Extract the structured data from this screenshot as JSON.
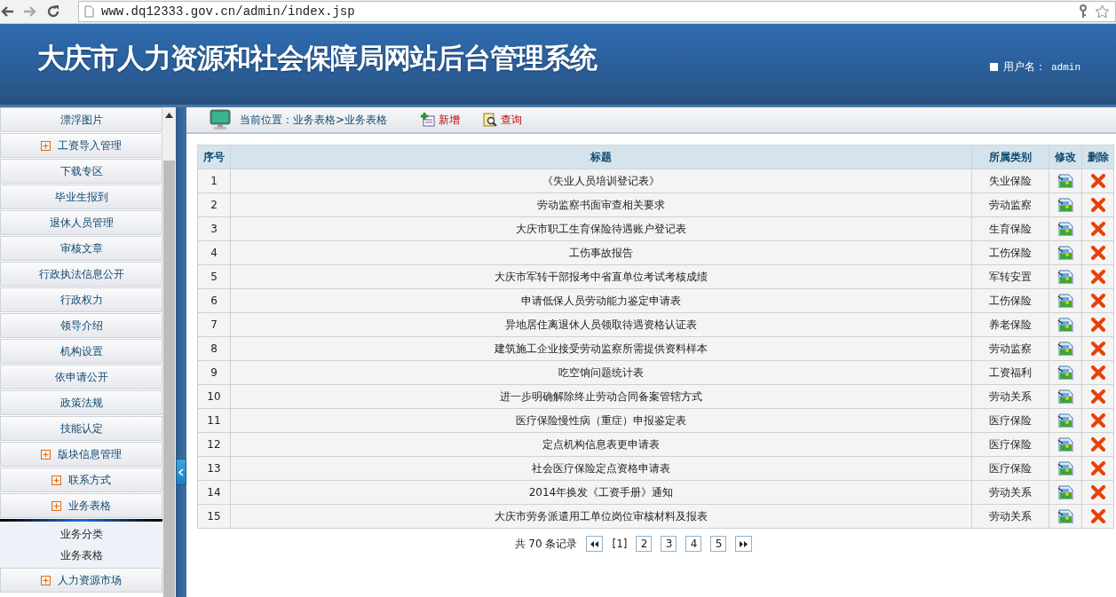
{
  "browser": {
    "url": "www.dq12333.gov.cn/admin/index.jsp"
  },
  "header": {
    "title": "大庆市人力资源和社会保障局网站后台管理系统",
    "user_label": "用户名：",
    "user_name": "admin"
  },
  "sidebar": {
    "items": [
      {
        "label": "漂浮图片",
        "kind": "link"
      },
      {
        "label": "工资导入管理",
        "kind": "group"
      },
      {
        "label": "下载专区",
        "kind": "link"
      },
      {
        "label": "毕业生报到",
        "kind": "link"
      },
      {
        "label": "退休人员管理",
        "kind": "link"
      },
      {
        "label": "审核文章",
        "kind": "link"
      },
      {
        "label": "行政执法信息公开",
        "kind": "link"
      },
      {
        "label": "行政权力",
        "kind": "link"
      },
      {
        "label": "领导介绍",
        "kind": "link"
      },
      {
        "label": "机构设置",
        "kind": "link"
      },
      {
        "label": "依申请公开",
        "kind": "link"
      },
      {
        "label": "政策法规",
        "kind": "link"
      },
      {
        "label": "技能认定",
        "kind": "link"
      },
      {
        "label": "版块信息管理",
        "kind": "group"
      },
      {
        "label": "联系方式",
        "kind": "group"
      },
      {
        "label": "业务表格",
        "kind": "group",
        "children": [
          {
            "label": "业务分类"
          },
          {
            "label": "业务表格"
          }
        ]
      },
      {
        "label": "人力资源市场",
        "kind": "group"
      }
    ]
  },
  "toolbar": {
    "location": "当前位置：业务表格>业务表格",
    "actions": [
      {
        "label": "新增",
        "kind": "add"
      },
      {
        "label": "查询",
        "kind": "search"
      }
    ]
  },
  "table": {
    "columns": [
      "序号",
      "标题",
      "所属类别",
      "修改",
      "删除"
    ],
    "rows": [
      {
        "no": "1",
        "title": "《失业人员培训登记表》",
        "category": "失业保险"
      },
      {
        "no": "2",
        "title": "劳动监察书面审查相关要求",
        "category": "劳动监察"
      },
      {
        "no": "3",
        "title": "大庆市职工生育保险待遇账户登记表",
        "category": "生育保险"
      },
      {
        "no": "4",
        "title": "工伤事故报告",
        "category": "工伤保险"
      },
      {
        "no": "5",
        "title": "大庆市军转干部报考中省直单位考试考核成绩",
        "category": "军转安置"
      },
      {
        "no": "6",
        "title": "申请低保人员劳动能力鉴定申请表",
        "category": "工伤保险"
      },
      {
        "no": "7",
        "title": "异地居住离退休人员领取待遇资格认证表",
        "category": "养老保险"
      },
      {
        "no": "8",
        "title": "建筑施工企业接受劳动监察所需提供资料样本",
        "category": "劳动监察"
      },
      {
        "no": "9",
        "title": "吃空饷问题统计表",
        "category": "工资福利"
      },
      {
        "no": "10",
        "title": "进一步明确解除终止劳动合同备案管辖方式",
        "category": "劳动关系"
      },
      {
        "no": "11",
        "title": "医疗保险慢性病（重症）申报鉴定表",
        "category": "医疗保险"
      },
      {
        "no": "12",
        "title": "定点机构信息表更申请表",
        "category": "医疗保险"
      },
      {
        "no": "13",
        "title": "社会医疗保险定点资格申请表",
        "category": "医疗保险"
      },
      {
        "no": "14",
        "title": "2014年换发《工资手册》通知",
        "category": "劳动关系"
      },
      {
        "no": "15",
        "title": "大庆市劳务派遣用工单位岗位审核材料及报表",
        "category": "劳动关系"
      }
    ]
  },
  "pagination": {
    "total_prefix": "共",
    "total": "70",
    "total_suffix": "条记录",
    "pages": [
      {
        "label": "[1]",
        "selected": true
      },
      {
        "label": "2",
        "selected": false
      },
      {
        "label": "3",
        "selected": false
      },
      {
        "label": "4",
        "selected": false
      },
      {
        "label": "5",
        "selected": false
      }
    ]
  }
}
